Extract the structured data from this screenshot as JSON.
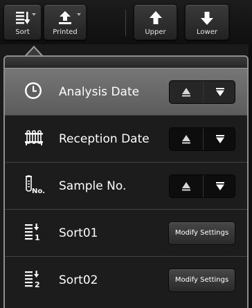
{
  "toolbar": {
    "sort_label": "Sort",
    "printed_label": "Printed",
    "upper_label": "Upper",
    "lower_label": "Lower"
  },
  "sort_menu": {
    "rows": [
      {
        "label": "Analysis Date",
        "icon": "clock-icon",
        "control": "asc-desc",
        "selected": true
      },
      {
        "label": "Reception Date",
        "icon": "test-tube-rack-icon",
        "control": "asc-desc",
        "selected": false
      },
      {
        "label": "Sample No.",
        "icon": "sample-tube-no-icon",
        "control": "asc-desc",
        "selected": false
      },
      {
        "label": "Sort01",
        "icon": "sort-1-icon",
        "control": "modify",
        "button_label": "Modify Settings"
      },
      {
        "label": "Sort02",
        "icon": "sort-2-icon",
        "control": "modify",
        "button_label": "Modify Settings"
      }
    ]
  },
  "colors": {
    "selected_row": "#6a6a6a",
    "panel_border": "#8e8e8e",
    "background": "#1a1a1a"
  }
}
